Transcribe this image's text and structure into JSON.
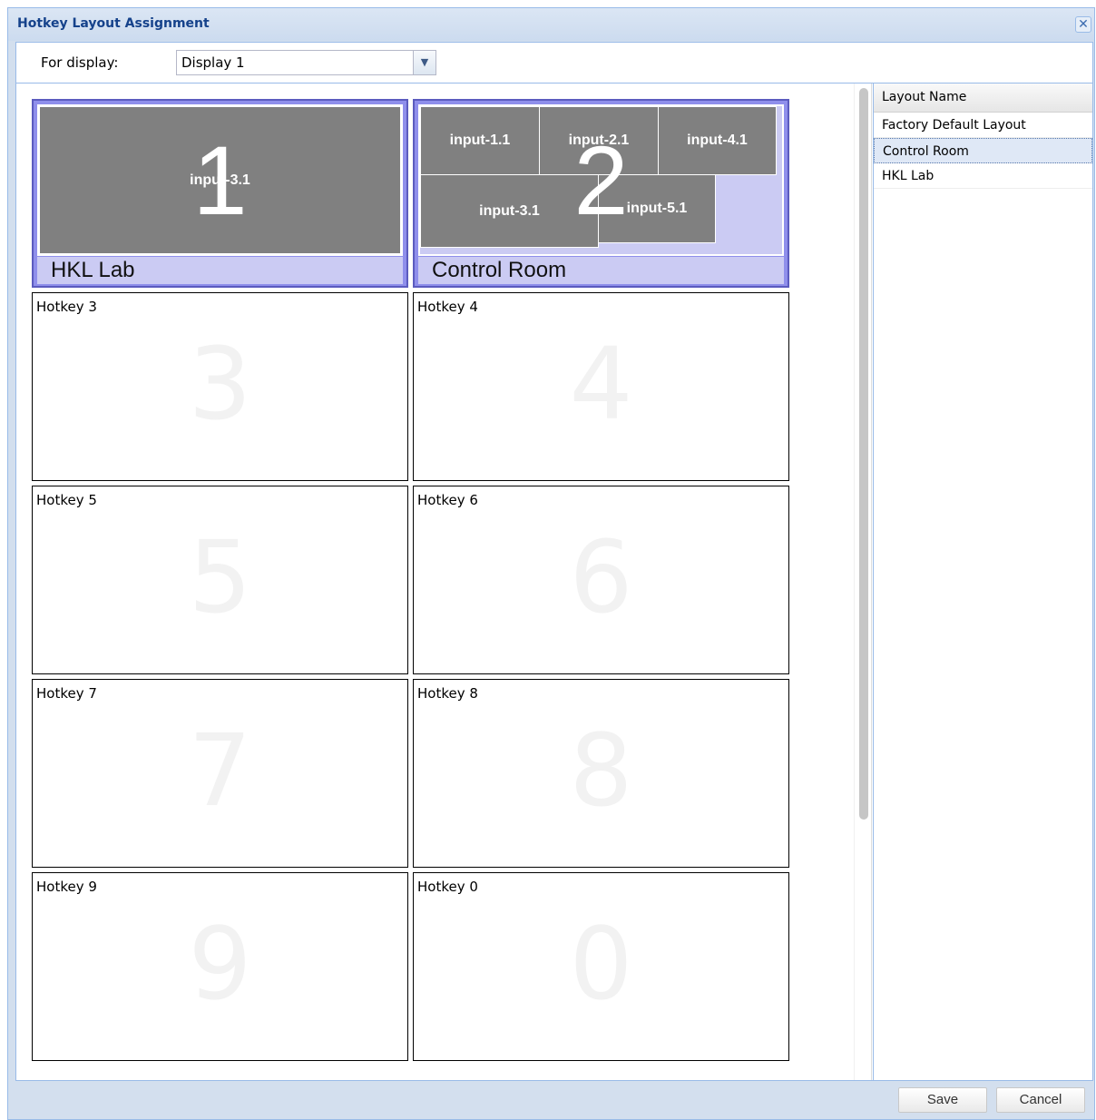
{
  "window": {
    "title": "Hotkey Layout Assignment"
  },
  "display": {
    "label": "For display:",
    "value": "Display 1"
  },
  "hotkeys": [
    {
      "number": "1",
      "layout_name": "HKL Lab",
      "windows": [
        {
          "label": "input-3.1"
        }
      ]
    },
    {
      "number": "2",
      "layout_name": "Control Room",
      "windows": [
        {
          "label": "input-1.1"
        },
        {
          "label": "input-2.1"
        },
        {
          "label": "input-4.1"
        },
        {
          "label": "input-3.1"
        },
        {
          "label": "input-5.1"
        }
      ]
    },
    {
      "label": "Hotkey 3",
      "number": "3"
    },
    {
      "label": "Hotkey 4",
      "number": "4"
    },
    {
      "label": "Hotkey 5",
      "number": "5"
    },
    {
      "label": "Hotkey 6",
      "number": "6"
    },
    {
      "label": "Hotkey 7",
      "number": "7"
    },
    {
      "label": "Hotkey 8",
      "number": "8"
    },
    {
      "label": "Hotkey 9",
      "number": "9"
    },
    {
      "label": "Hotkey 0",
      "number": "0"
    }
  ],
  "layout_list": {
    "header": "Layout Name",
    "items": [
      "Factory Default Layout",
      "Control Room",
      "HKL Lab"
    ],
    "selected": "Control Room"
  },
  "buttons": {
    "save": "Save",
    "cancel": "Cancel"
  },
  "icons": {
    "close": "close-icon",
    "dropdown": "chevron-down-icon"
  },
  "colors": {
    "title_text": "#15428b",
    "assigned_tile": "#8f8feb",
    "layout_window": "#808080",
    "selected_row": "#dfe8f6"
  }
}
